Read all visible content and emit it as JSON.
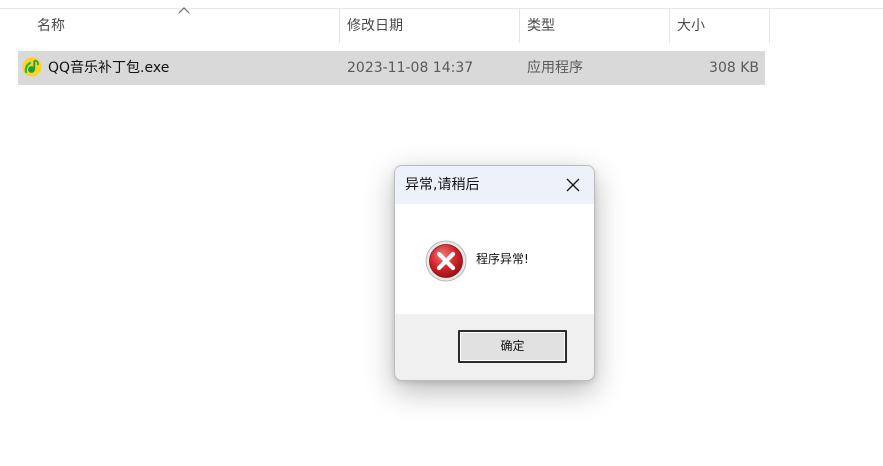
{
  "columns": {
    "name": "名称",
    "modified": "修改日期",
    "type": "类型",
    "size": "大小"
  },
  "file": {
    "name": "QQ音乐补丁包.exe",
    "modified": "2023-11-08 14:37",
    "type": "应用程序",
    "size": "308 KB",
    "icon": "qq-music-icon"
  },
  "dialog": {
    "title": "异常,请稍后",
    "message": "程序异常!",
    "ok_label": "确定",
    "icon": "error-icon",
    "close_icon": "close-icon"
  },
  "colors": {
    "selected_row": "#d9d9d9",
    "dialog_title_bar": "#edf1fa",
    "error_red": "#c8262b"
  }
}
